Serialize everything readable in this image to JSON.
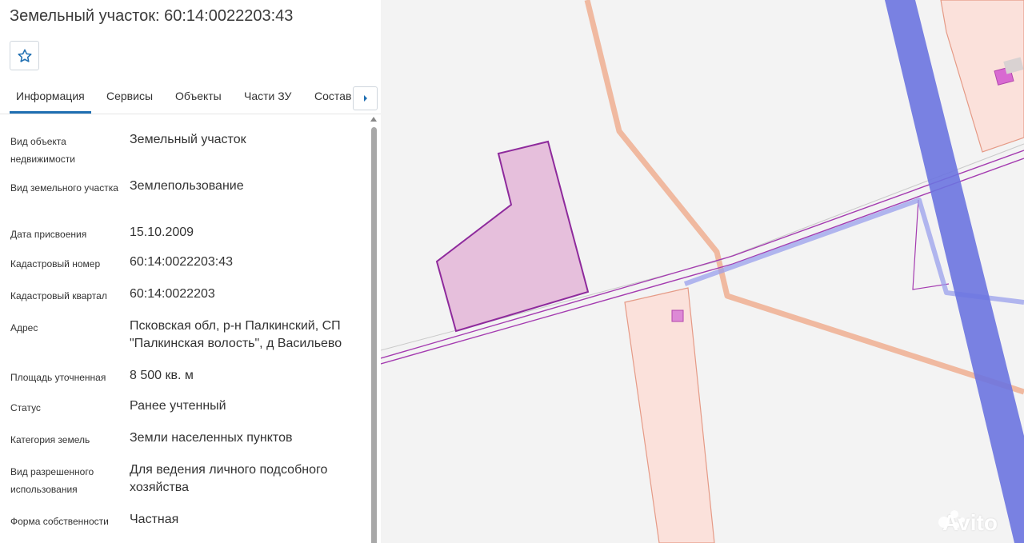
{
  "title": "Земельный участок: 60:14:0022203:43",
  "tabs": [
    {
      "label": "Информация",
      "active": true
    },
    {
      "label": "Сервисы",
      "active": false
    },
    {
      "label": "Объекты",
      "active": false
    },
    {
      "label": "Части ЗУ",
      "active": false
    },
    {
      "label": "Состав",
      "active": false
    }
  ],
  "icons": {
    "favorite": "star-icon",
    "tabs_next": "chevron-right-icon",
    "watermark": "avito-logo"
  },
  "rows": [
    {
      "label": "Вид объекта недвижимости",
      "value": "Земельный участок"
    },
    {
      "label": "Вид земельного участка",
      "value": "Землепользование"
    },
    {
      "label": "Дата присвоения",
      "value": "15.10.2009"
    },
    {
      "label": "Кадастровый номер",
      "value": "60:14:0022203:43"
    },
    {
      "label": "Кадастровый квартал",
      "value": "60:14:0022203"
    },
    {
      "label": "Адрес",
      "value": "Псковская обл, р-н Палкинский, СП \"Палкинская волость\", д Васильево"
    },
    {
      "label": "Площадь уточненная",
      "value": "8 500 кв. м"
    },
    {
      "label": "Статус",
      "value": "Ранее учтенный"
    },
    {
      "label": "Категория земель",
      "value": "Земли населенных пунктов"
    },
    {
      "label": "Вид разрешенного использования",
      "value": "Для ведения личного подсобного хозяйства"
    },
    {
      "label": "Форма собственности",
      "value": "Частная"
    }
  ],
  "watermark": {
    "text": "Avito"
  },
  "colors": {
    "accent": "#1f6fb2",
    "selected_parcel_fill": "#e6bfdc",
    "selected_parcel_stroke": "#8e2a9c",
    "boundary_orange": "#f0b9a0",
    "parcel_pink_fill": "#fbe1db",
    "zone_blue": "#6b74e0",
    "road_purple": "#a43bb0"
  }
}
